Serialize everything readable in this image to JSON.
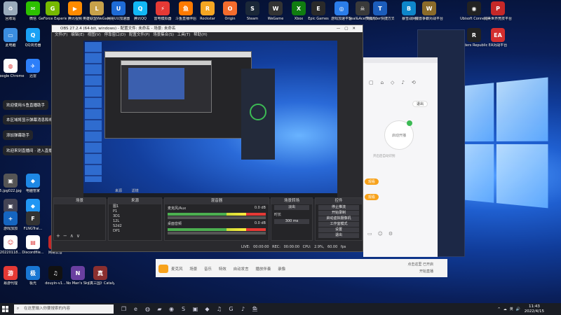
{
  "desktop": {
    "icons": [
      {
        "label": "回收站",
        "color": "#9ab",
        "glyph": "♻",
        "pos": "r0c0"
      },
      {
        "label": "微信",
        "color": "#2dc100",
        "glyph": "✉",
        "pos": "r0c1"
      },
      {
        "label": "GeForce Experience",
        "color": "#76b900",
        "glyph": "G",
        "pos": "r0c2"
      },
      {
        "label": "腾讯视频",
        "color": "#ff8b00",
        "glyph": "▶",
        "pos": "r0c3"
      },
      {
        "label": "英雄联盟WeGame",
        "color": "#c8a24a",
        "glyph": "L",
        "pos": "r0c4"
      },
      {
        "label": "网易UU加速器",
        "color": "#1e6bd6",
        "glyph": "U",
        "pos": "r0c5"
      },
      {
        "label": "腾讯QQ",
        "color": "#12b7f5",
        "glyph": "Q",
        "pos": "r0c6"
      },
      {
        "label": "雷电模拟器",
        "color": "#e53935",
        "glyph": "⚡",
        "pos": "r0c7"
      },
      {
        "label": "斗鱼直播伴侣",
        "color": "#ff7a00",
        "glyph": "鱼",
        "pos": "r0c8"
      },
      {
        "label": "Rockstar",
        "color": "#f5a623",
        "glyph": "R",
        "pos": "r0c9"
      },
      {
        "label": "Origin",
        "color": "#f56c2d",
        "glyph": "O",
        "pos": "r0c10"
      },
      {
        "label": "Steam",
        "color": "#1b2838",
        "glyph": "S",
        "pos": "r0c11"
      },
      {
        "label": "WeGame",
        "color": "#333",
        "glyph": "W",
        "pos": "r0c12"
      },
      {
        "label": "Xbox",
        "color": "#107c10",
        "glyph": "X",
        "pos": "r0c13"
      },
      {
        "label": "Epic Games",
        "color": "#2a2a2a",
        "glyph": "E",
        "pos": "r0c14"
      },
      {
        "label": "游戏加速平台",
        "color": "#2b7de9",
        "glyph": "◎",
        "pos": "r0c15"
      },
      {
        "label": "Seal&Ace快捷方式",
        "color": "#3a3a3a",
        "glyph": "☠",
        "pos": "r0c16"
      },
      {
        "label": "Thunder快捷方式",
        "color": "#1c5dbb",
        "glyph": "T",
        "pos": "r0c17"
      },
      {
        "label": "暴雪战网",
        "color": "#0e86ca",
        "glyph": "B",
        "pos": "r0c18"
      },
      {
        "label": "魔兽争霸对战平台",
        "color": "#8b6b2a",
        "glyph": "W",
        "pos": "r0c19"
      },
      {
        "label": "Ubisoft Connect",
        "color": "#222",
        "glyph": "◉",
        "pos": "r0c20"
      },
      {
        "label": "完美世界竞技平台",
        "color": "#c62828",
        "glyph": "P",
        "pos": "r0c21"
      },
      {
        "label": "此电脑",
        "color": "#3b8de0",
        "glyph": "▭",
        "pos": "r1c0"
      },
      {
        "label": "QQ浏览器",
        "color": "#1aa1f5",
        "glyph": "Q",
        "pos": "r1c1"
      },
      {
        "label": "Google Chrome",
        "color": "#fff",
        "glyph": "◍",
        "pos": "r2c0"
      },
      {
        "label": "迅雷",
        "color": "#2d7ff9",
        "glyph": "✈",
        "pos": "r2c1"
      },
      {
        "label": "Riders Republic",
        "color": "#222",
        "glyph": "R",
        "pos": "r1c20"
      },
      {
        "label": "EA对战平台",
        "color": "#d32f2f",
        "glyph": "EA",
        "pos": "r1c21"
      },
      {
        "label": "5.jpg022.jpg",
        "color": "#555",
        "glyph": "▣",
        "pos": "r5c0"
      },
      {
        "label": "电脑管家",
        "color": "#1e88e5",
        "glyph": "◆",
        "pos": "r5c1"
      },
      {
        "label": "5.jpg",
        "color": "#445",
        "glyph": "▣",
        "pos": "r6c0"
      },
      {
        "label": "电脑管家",
        "color": "#2196f3",
        "glyph": "◆",
        "pos": "r6c1"
      },
      {
        "label": "游戏加加",
        "color": "#1565c0",
        "glyph": "+",
        "pos": "r7c0"
      },
      {
        "label": "FLNGTrai...",
        "color": "#333",
        "glyph": "F",
        "pos": "r7c1"
      },
      {
        "label": "20220118...",
        "color": "#fff",
        "glyph": "☺",
        "pos": "r8c0"
      },
      {
        "label": "Discordfile...",
        "color": "#fff",
        "glyph": "▤",
        "pos": "r8c1"
      },
      {
        "label": "网易云音",
        "color": "#c62828",
        "glyph": "♪",
        "pos": "r8c2"
      },
      {
        "label": "易游代理",
        "color": "#e53935",
        "glyph": "游",
        "pos": "r9c0"
      },
      {
        "label": "极光",
        "color": "#1976d2",
        "glyph": "极",
        "pos": "r9c1"
      },
      {
        "label": "douyin-v1...",
        "color": "#111",
        "glyph": "♫",
        "pos": "r9c2"
      },
      {
        "label": "No Man's Sky",
        "color": "#6a3fa0",
        "glyph": "N",
        "pos": "r9c3"
      },
      {
        "label": "《真三国》Catalyst",
        "color": "#8a2f2f",
        "glyph": "真",
        "pos": "r9c4"
      }
    ],
    "toasts": [
      "欢迎使用斗鱼直播助手",
      "本区域将显示弹幕消息和礼物消息",
      "添加弹幕助手",
      "欢迎来到直播间 · 进入直播间"
    ]
  },
  "obs": {
    "title": "OBS 27.2.4 (64-bit, windows) - 配置文件: 未命名 - 场景: 未命名",
    "menu": [
      "文件(F)",
      "编辑(E)",
      "视图(V)",
      "停靠窗口(D)",
      "配置文件(P)",
      "场景集合(S)",
      "工具(T)",
      "帮助(H)"
    ],
    "preview_tabs": [
      "来源",
      "滤镜"
    ],
    "panels": {
      "scenes": {
        "title": "场景",
        "items": []
      },
      "sources": {
        "title": "来源",
        "items": [
          "图1",
          "P1",
          "3D1",
          "12L",
          "S2d2",
          "DP1"
        ]
      },
      "mixer": {
        "title": "混音器",
        "tracks": [
          {
            "name": "麦克风/Aux",
            "level": "0.0 dB"
          },
          {
            "name": "桌面音频",
            "level": "0.0 dB"
          }
        ]
      },
      "transitions": {
        "title": "场景转场",
        "items": [
          "淡出",
          "时长",
          "300 ms"
        ]
      },
      "controls": {
        "title": "控件",
        "items": [
          "停止推流",
          "开始录制",
          "启动虚拟摄像机",
          "工作室模式",
          "设置",
          "退出"
        ]
      }
    },
    "statusbar": [
      "LIVE: 00:00:00",
      "REC: 00:00:00",
      "CPU: 2.9%, 60.00 fps"
    ]
  },
  "app": {
    "title": "斗鱼直播伴侣",
    "circle_text": "启动开播",
    "exit_label": "退出",
    "note": "开启后自动识别",
    "tags": [
      "观看",
      "观看"
    ]
  },
  "bottombar": {
    "items": [
      "麦克风",
      "场景",
      "音乐",
      "特效",
      "自动发言",
      "播放伴奏",
      "录像"
    ],
    "status": "点击这里 已开启",
    "sub": "开始直播"
  },
  "taskbar": {
    "search_placeholder": "在这里输入你要搜索的内容",
    "pinned": [
      "task-view",
      "edge",
      "chrome",
      "file-explorer",
      "obs",
      "steam",
      "store",
      "vsc",
      "tiktok",
      "game",
      "music",
      "douyu"
    ],
    "time": "11:43",
    "date": "2022/4/15",
    "tray": [
      "^",
      "☁",
      "英",
      "🔊"
    ]
  }
}
